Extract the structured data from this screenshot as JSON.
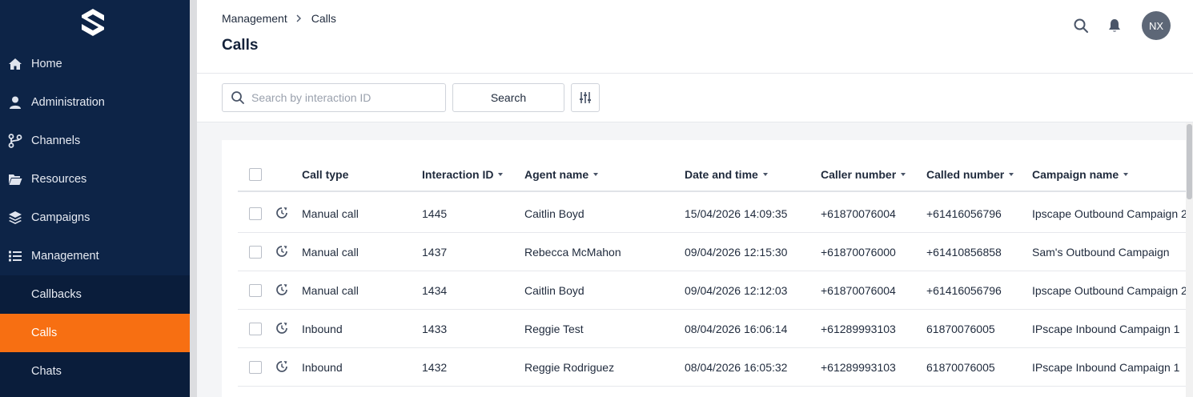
{
  "nav": {
    "items": [
      {
        "label": "Home",
        "icon": "home-icon"
      },
      {
        "label": "Administration",
        "icon": "user-icon"
      },
      {
        "label": "Channels",
        "icon": "branch-icon"
      },
      {
        "label": "Resources",
        "icon": "folder-icon"
      },
      {
        "label": "Campaigns",
        "icon": "layers-icon"
      },
      {
        "label": "Management",
        "icon": "list-icon"
      }
    ],
    "sub_items": [
      {
        "label": "Callbacks",
        "active": false
      },
      {
        "label": "Calls",
        "active": true
      },
      {
        "label": "Chats",
        "active": false
      }
    ]
  },
  "header": {
    "breadcrumb": {
      "parent": "Management",
      "current": "Calls"
    },
    "title": "Calls",
    "avatar_initials": "NX"
  },
  "toolbar": {
    "search_placeholder": "Search by interaction ID",
    "search_value": "",
    "search_button": "Search"
  },
  "table": {
    "columns": [
      "Call type",
      "Interaction ID",
      "Agent name",
      "Date and time",
      "Caller number",
      "Called number",
      "Campaign name"
    ],
    "rows": [
      [
        "Manual call",
        "1445",
        "Caitlin Boyd",
        "15/04/2026 14:09:35",
        "+61870076004",
        "+61416056796",
        "Ipscape Outbound Campaign 2"
      ],
      [
        "Manual call",
        "1437",
        "Rebecca McMahon",
        "09/04/2026 12:15:30",
        "+61870076000",
        "+61410856858",
        "Sam's Outbound Campaign"
      ],
      [
        "Manual call",
        "1434",
        "Caitlin Boyd",
        "09/04/2026 12:12:03",
        "+61870076004",
        "+61416056796",
        "Ipscape Outbound Campaign 2"
      ],
      [
        "Inbound",
        "1433",
        "Reggie Test",
        "08/04/2026 16:06:14",
        "+61289993103",
        "61870076005",
        "IPscape Inbound Campaign 1"
      ],
      [
        "Inbound",
        "1432",
        "Reggie Rodriguez",
        "08/04/2026 16:05:32",
        "+61289993103",
        "61870076005",
        "IPscape Inbound Campaign 1"
      ]
    ]
  },
  "colors": {
    "sidebar_bg": "#0d2447",
    "active_accent": "#f76f12",
    "avatar_bg": "#5d6777"
  }
}
